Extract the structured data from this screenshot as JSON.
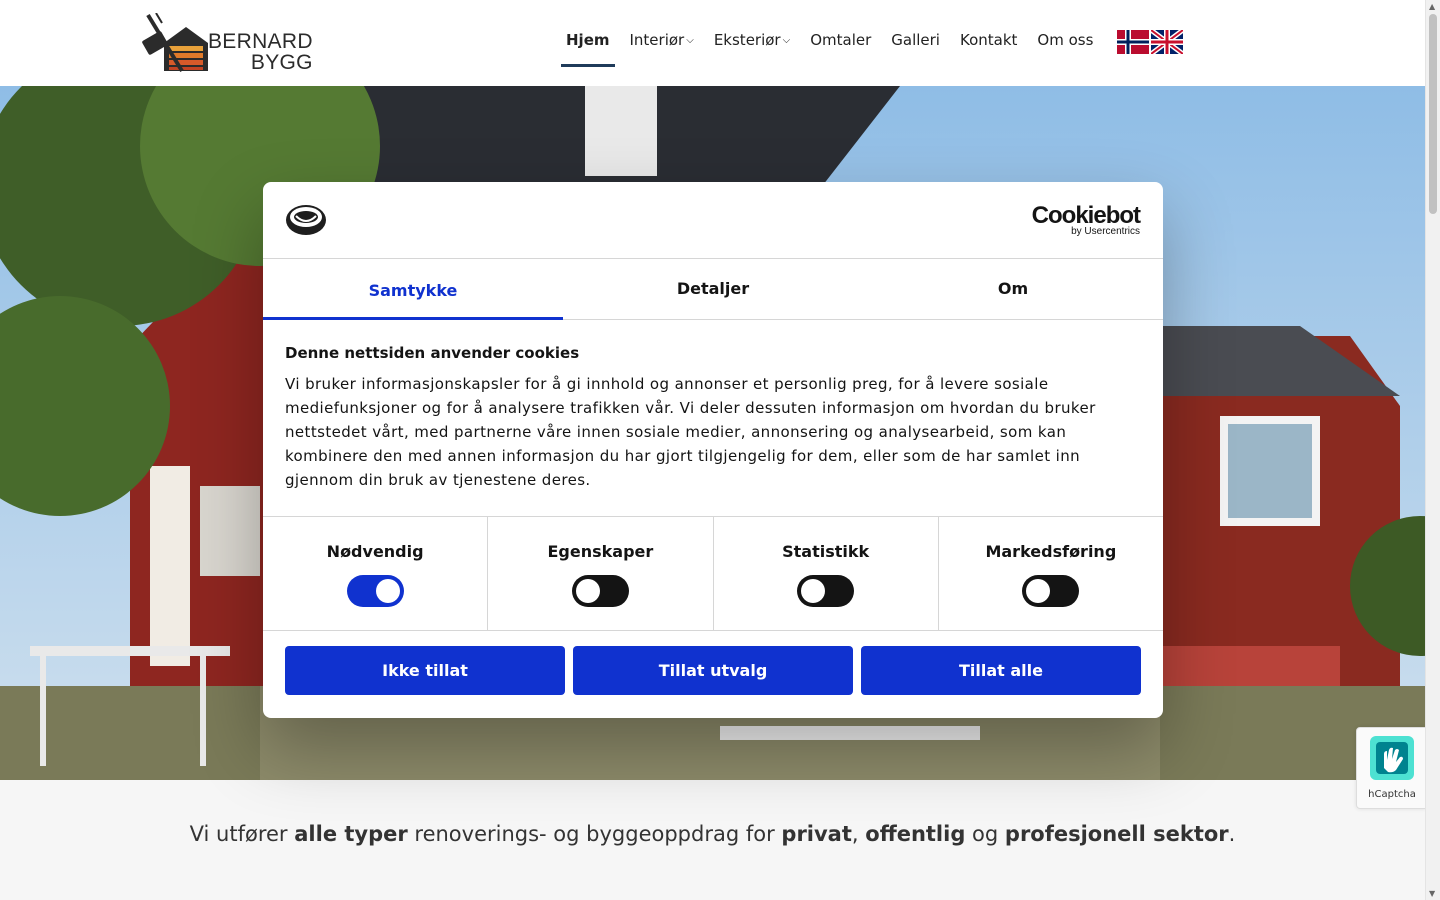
{
  "header": {
    "logo_line1": "BERNARD",
    "logo_line2": "BYGG",
    "nav": [
      {
        "label": "Hjem",
        "active": true
      },
      {
        "label": "Interiør",
        "dropdown": true
      },
      {
        "label": "Eksteriør",
        "dropdown": true
      },
      {
        "label": "Omtaler"
      },
      {
        "label": "Galleri"
      },
      {
        "label": "Kontakt"
      },
      {
        "label": "Om oss"
      }
    ],
    "flags": [
      "norwegian-flag-icon",
      "uk-flag-icon"
    ]
  },
  "cookie_dialog": {
    "brand": "Cookiebot",
    "brand_sub": "by Usercentrics",
    "tabs": [
      "Samtykke",
      "Detaljer",
      "Om"
    ],
    "active_tab": "Samtykke",
    "title": "Denne nettsiden anvender cookies",
    "text": "Vi bruker informasjonskapsler for å gi innhold og annonser et personlig preg, for å levere sosiale mediefunksjoner og for å analysere trafikken vår. Vi deler dessuten informasjon om hvordan du bruker nettstedet vårt, med partnerne våre innen sosiale medier, annonsering og analysearbeid, som kan kombinere den med annen informasjon du har gjort tilgjengelig for dem, eller som de har samlet inn gjennom din bruk av tjenestene deres.",
    "toggles": [
      {
        "label": "Nødvendig",
        "on": true
      },
      {
        "label": "Egenskaper",
        "on": false
      },
      {
        "label": "Statistikk",
        "on": false
      },
      {
        "label": "Markedsføring",
        "on": false
      }
    ],
    "buttons": [
      "Ikke tillat",
      "Tillat utvalg",
      "Tillat alle"
    ]
  },
  "tagline": {
    "p1": "Vi utfører ",
    "b1": "alle typer",
    "p2": " renoverings- og byggeoppdrag for ",
    "b2": "privat",
    "p3": ", ",
    "b3": "offentlig",
    "p4": " og ",
    "b4": "profesjonell sektor",
    "p5": "."
  },
  "hcaptcha": {
    "label": "hCaptcha"
  },
  "colors": {
    "accent": "#1032cf",
    "text": "#141414",
    "nav_underline": "#1f3b5a"
  }
}
